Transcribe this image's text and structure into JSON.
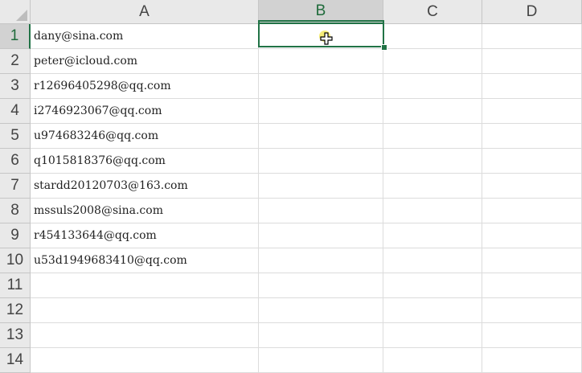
{
  "columns": [
    "A",
    "B",
    "C",
    "D"
  ],
  "rows": [
    "1",
    "2",
    "3",
    "4",
    "5",
    "6",
    "7",
    "8",
    "9",
    "10",
    "11",
    "12",
    "13",
    "14"
  ],
  "cells": [
    "dany@sina.com",
    "peter@icloud.com",
    "r12696405298@qq.com",
    "i2746923067@qq.com",
    "u974683246@qq.com",
    "q1015818376@qq.com",
    "stardd20120703@163.com",
    "mssuls2008@sina.com",
    "r454133644@qq.com",
    "u53d1949683410@qq.com",
    "",
    "",
    "",
    ""
  ],
  "selection": {
    "cell": "B1"
  },
  "colors": {
    "accent": "#217346",
    "cursor_highlight": "#f2e64a"
  }
}
